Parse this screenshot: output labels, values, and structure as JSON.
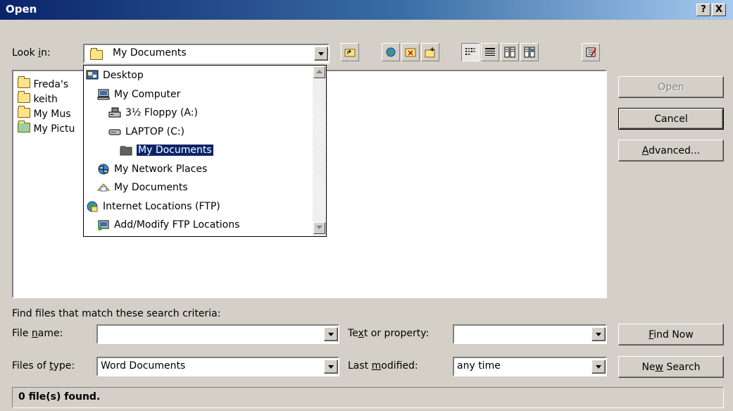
{
  "window": {
    "title": "Open",
    "help": "?",
    "close": "X"
  },
  "lookin": {
    "label_pre": "Look ",
    "label_ul": "i",
    "label_post": "n:",
    "value": "My Documents"
  },
  "files": [
    "Freda's",
    "keith",
    "My Mus",
    "My Pictu"
  ],
  "dropdown": {
    "items": [
      {
        "label": "Desktop",
        "icon": "desktop-icon"
      },
      {
        "label": "My Computer",
        "icon": "computer-icon"
      },
      {
        "label": "3½ Floppy (A:)",
        "icon": "floppy-icon"
      },
      {
        "label": "LAPTOP (C:)",
        "icon": "drive-icon"
      },
      {
        "label": "My Documents",
        "icon": "folder-icon"
      },
      {
        "label": "My Network Places",
        "icon": "network-icon"
      },
      {
        "label": "My Documents",
        "icon": "my-documents-icon"
      },
      {
        "label": "Internet Locations (FTP)",
        "icon": "globe-icon"
      },
      {
        "label": "Add/Modify FTP Locations",
        "icon": "ftp-icon"
      }
    ]
  },
  "buttons": {
    "open": "Open",
    "cancel": "Cancel",
    "advanced_ul": "A",
    "advanced_rest": "dvanced...",
    "find_now_ul": "F",
    "find_now_rest": "ind Now",
    "new_search_pre": "Ne",
    "new_search_ul": "w",
    "new_search_post": " Search"
  },
  "criteria": {
    "heading": "Find files that match these search criteria:",
    "filename_pre": "File ",
    "filename_ul": "n",
    "filename_post": "ame:",
    "filename_value": "",
    "text_pre": "Te",
    "text_ul": "x",
    "text_post": "t or property:",
    "text_value": "",
    "filetype_pre": "Files of ",
    "filetype_ul": "t",
    "filetype_post": "ype:",
    "filetype_value": "Word Documents",
    "modified_pre": "Last ",
    "modified_ul": "m",
    "modified_post": "odified:",
    "modified_value": "any time"
  },
  "status": "0 file(s) found."
}
